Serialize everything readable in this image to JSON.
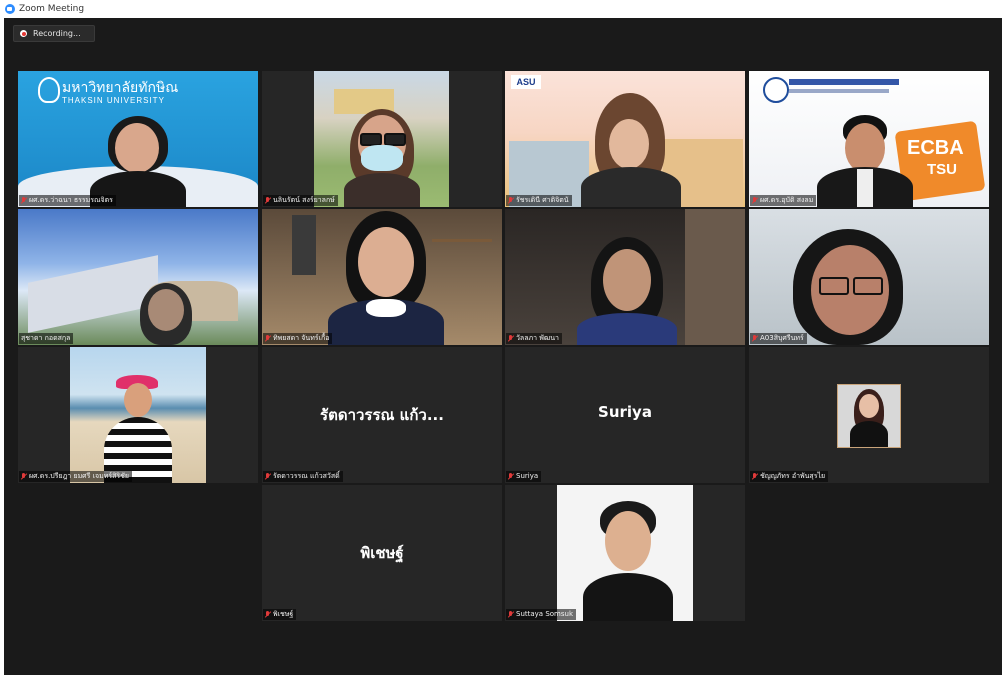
{
  "window": {
    "title": "Zoom Meeting"
  },
  "recording": {
    "label": "Recording..."
  },
  "tiles": [
    {
      "label": "ผศ.ดร.ว่าฉนา ธรรมรณจิตร",
      "logo_line1": "มหาวิทยาลัยทักษิณ",
      "logo_line2": "THAKSIN UNIVERSITY"
    },
    {
      "label": "นลินรัตน์ สงร์ยาลกษ์"
    },
    {
      "label": "รัชรเดินี ศาติจิตนั",
      "logo": "ASU"
    },
    {
      "label": "ผศ.ดร.อุบัติ สงลม",
      "logo": "ECBA",
      "logo2": "TSU"
    },
    {
      "label": "สุชาดา กอดสกุล"
    },
    {
      "label": "ทิพยสดา จันทร์เกื้อ"
    },
    {
      "label": "วัลลภา พัฒนา"
    },
    {
      "label": "A03สิบุศรีนทร์"
    },
    {
      "label": "ผศ.ดร.ปรียฎา ยมศรี เจมทร์สิริชัย"
    },
    {
      "label": "รัตดาวรรณ แก้วสวัสดิ์",
      "display_name": "รัตดาวรรณ แก้ว..."
    },
    {
      "label": "Suriya",
      "display_name": "Suriya"
    },
    {
      "label": "ชัญญภัทร อำพันสุรไย"
    },
    {
      "label": "พิเชษฐ์",
      "display_name": "พิเชษฐ์"
    },
    {
      "label": "Suttaya Somsuk"
    }
  ],
  "colors": {
    "meeting_bg": "#1a1a1a",
    "tile_bg": "#262626",
    "active_border": "#d8db5e",
    "muted_mic": "#e03a3a",
    "zoom_blue": "#2d8cff"
  }
}
